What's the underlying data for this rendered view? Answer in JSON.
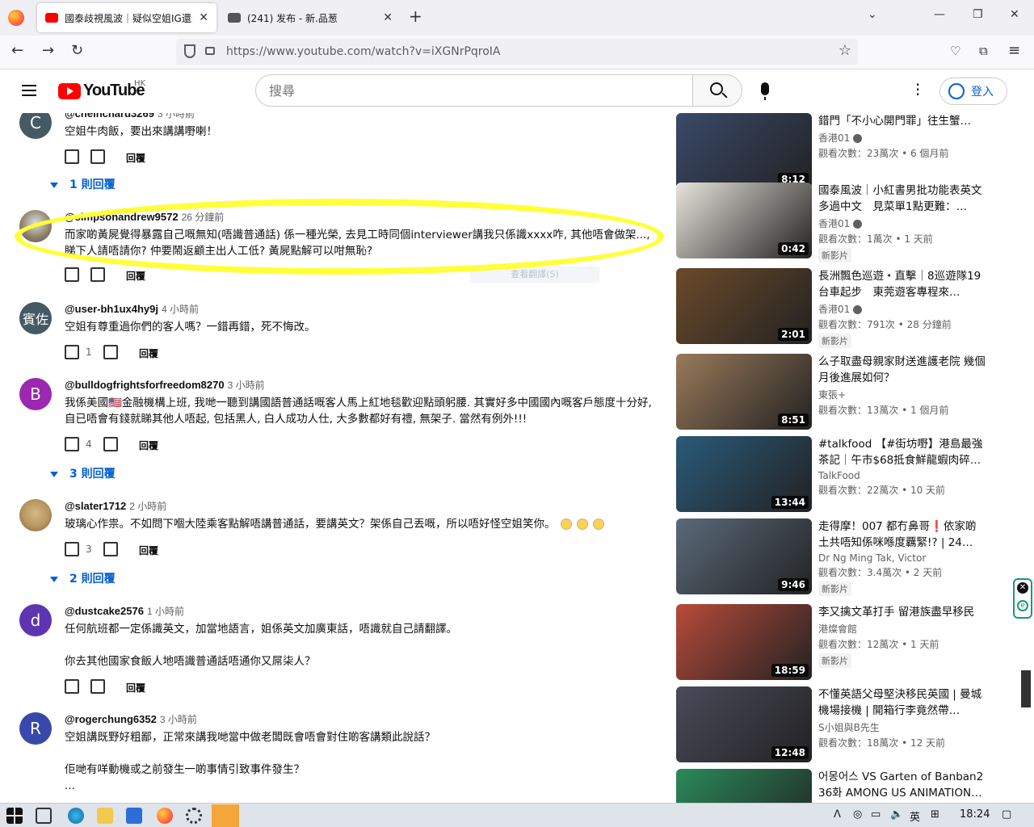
{
  "browser": {
    "tabs": [
      {
        "title": "國泰歧視風波｜疑似空姐IG還擊",
        "active": true
      },
      {
        "title": "(241) 发布 - 新.品葱",
        "active": false
      }
    ],
    "new_tab": "+",
    "url": "https://www.youtube.com/watch?v=iXGNrPqroIA"
  },
  "youtube": {
    "logo": "YouTube",
    "region": "HK",
    "search_placeholder": "搜尋",
    "signin": "登入"
  },
  "comments": [
    {
      "avatar": "C",
      "avatar_color": "#455a64",
      "author": "@chelnchard3269",
      "time": "3 小時前",
      "text": "空姐牛肉飯，要出來講講嘢喇！",
      "likes": "",
      "replies": "1 則回覆"
    },
    {
      "avatar": "",
      "avatar_color": "#8a7d66",
      "author": "@simpsonandrew9572",
      "time": "26 分鐘前",
      "text": "而家啲黃屍覺得暴露自己嘅無知(唔識普通話) 係一種光榮, 去見工時同個interviewer講我只係識xxxx咋, 其他唔會做架..., 睇下人請唔請你? 仲要鬧返顧主出人工低? 黃屍點解可以咁無恥?",
      "likes": "",
      "replies": ""
    },
    {
      "avatar": "賓佐",
      "avatar_color": "#455a64",
      "author": "@user-bh1ux4hy9j",
      "time": "4 小時前",
      "text": "空姐有尊重過你們的客人嗎？一錯再錯，死不悔改。",
      "likes": "1",
      "replies": ""
    },
    {
      "avatar": "B",
      "avatar_color": "#9c27b0",
      "author": "@bulldogfrightsforfreedom8270",
      "time": "3 小時前",
      "text": "我係美國🇺🇸金融機構上班, 我哋一聽到講國語普通話嘅客人馬上紅地毯歡迎點頭躬腰. 其實好多中國國內嘅客戶態度十分好, 自已唔會有錢就睇其他人唔起, 包括黑人, 白人成功人仕, 大多數都好有禮, 無架子. 當然有例外!!!",
      "likes": "4",
      "replies": "3 則回覆"
    },
    {
      "avatar": "",
      "avatar_color": "#b59660",
      "author": "@slater1712",
      "time": "2 小時前",
      "text": "玻璃心作祟。不如問下嗰大陸乘客點解唔講普通話，要講英文？架係自己丟嘅，所以唔好怪空姐笑你。",
      "likes": "3",
      "replies": "2 則回覆"
    },
    {
      "avatar": "d",
      "avatar_color": "#5e35b1",
      "author": "@dustcake2576",
      "time": "1 小時前",
      "text": "任何航班都一定係識英文，加當地語言，姐係英文加廣東話，唔識就自己請翻譯。\n\n你去其他國家食飯人地唔識普通話唔通你又屌柒人？",
      "likes": "",
      "replies": ""
    },
    {
      "avatar": "R",
      "avatar_color": "#3949ab",
      "author": "@rogerchung6352",
      "time": "3 小時前",
      "text": "空姐講既野好粗鄙，正常來講我哋當中做老闆既會唔會對住啲客講類此說話？\n\n佢哋有咩動機或之前發生一啲事情引致事件發生？\n...",
      "likes": "",
      "replies": ""
    }
  ],
  "comment_actions": {
    "reply": "回覆"
  },
  "ghost_text": "查看翻譯(S)",
  "related": [
    {
      "title": "錯門「不小心開門罪」往生蟹…",
      "channel": "香港01",
      "verified": true,
      "meta": "觀看次數：23萬次 • 6 個月前",
      "badge": "",
      "duration": "8:12",
      "thumb": "#3a4a6a"
    },
    {
      "title": "國泰風波｜小紅書男批功能表英文多過中文　見菜單1點更難：…",
      "channel": "香港01",
      "verified": true,
      "meta": "觀看次數：1萬次 • 1 天前",
      "badge": "新影片",
      "duration": "0:42",
      "thumb": "#e8e4dc"
    },
    {
      "title": "長洲飄色巡遊・直擊｜8巡遊隊19台車起步　東莞遊客專程來…",
      "channel": "香港01",
      "verified": true,
      "meta": "觀看次數：791次 • 28 分鐘前",
      "badge": "新影片",
      "duration": "2:01",
      "thumb": "#6b4a2a"
    },
    {
      "title": "么子取盡母親家財送進護老院 幾個月後進展如何？",
      "channel": "東張+",
      "verified": false,
      "meta": "觀看次數：13萬次 • 1 個月前",
      "badge": "",
      "duration": "8:51",
      "thumb": "#9a7a5a"
    },
    {
      "title": "#talkfood 【#街坊嘢】港島最強茶記｜午市$68抵食鮮龍蝦肉碎…",
      "channel": "TalkFood",
      "verified": false,
      "meta": "觀看次數：22萬次 • 10 天前",
      "badge": "",
      "duration": "13:44",
      "thumb": "#2a5a7a"
    },
    {
      "title": "走得摩！007 都冇鼻哥❗依家啲土共唔知係咪喺度覊緊!? | 24…",
      "channel": "Dr Ng Ming Tak, Victor",
      "verified": false,
      "meta": "觀看次數：3.4萬次 • 2 天前",
      "badge": "新影片",
      "duration": "9:46",
      "thumb": "#5a6a7a"
    },
    {
      "title": "李又擒文革打手 留港族盡早移民",
      "channel": "港燦會館",
      "verified": false,
      "meta": "觀看次數：12萬次 • 1 天前",
      "badge": "新影片",
      "duration": "18:59",
      "thumb": "#b84a3a"
    },
    {
      "title": "不懂英語父母堅決移民英國 | 曼城機場接機 | 開箱行李竟然帶…",
      "channel": "S小姐與B先生",
      "verified": false,
      "meta": "觀看次數：18萬次 • 12 天前",
      "badge": "",
      "duration": "12:48",
      "thumb": "#4a4a5a"
    },
    {
      "title": "어몽어스 VS Garten of Banban2 36화 AMONG US ANIMATION…",
      "channel": "",
      "verified": false,
      "meta": "",
      "badge": "",
      "duration": "",
      "thumb": "#2a8a5a"
    }
  ],
  "taskbar": {
    "ime": "英",
    "clock": "18:24"
  }
}
